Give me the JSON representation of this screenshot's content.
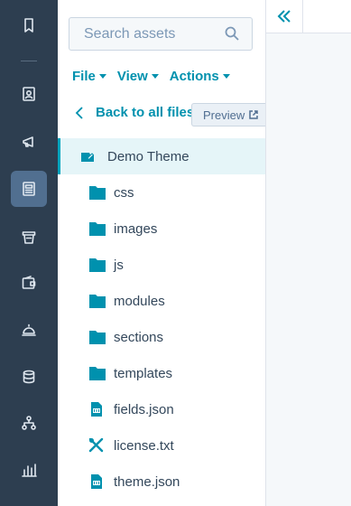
{
  "nav": {
    "items": [
      {
        "icon": "bookmark-icon"
      },
      {
        "icon": "contacts-icon"
      },
      {
        "icon": "megaphone-icon"
      },
      {
        "icon": "content-icon",
        "active": true
      },
      {
        "icon": "store-icon"
      },
      {
        "icon": "wallet-icon"
      },
      {
        "icon": "service-bell-icon"
      },
      {
        "icon": "database-icon"
      },
      {
        "icon": "automation-icon"
      },
      {
        "icon": "reports-icon"
      }
    ]
  },
  "search": {
    "placeholder": "Search assets"
  },
  "menus": {
    "file": "File",
    "view": "View",
    "actions": "Actions"
  },
  "back_label": "Back to all files",
  "preview_label": "Preview",
  "tree": {
    "root": "Demo Theme",
    "folders": [
      "css",
      "images",
      "js",
      "modules",
      "sections",
      "templates"
    ],
    "files": [
      {
        "name": "fields.json",
        "icon": "json-file-icon"
      },
      {
        "name": "license.txt",
        "icon": "tools-icon"
      },
      {
        "name": "theme.json",
        "icon": "json-file-icon"
      }
    ]
  },
  "colors": {
    "accent": "#0091ae",
    "nav_bg": "#2d3e50",
    "selected_bg": "#e5f5f8",
    "folder": "#0091ae"
  }
}
